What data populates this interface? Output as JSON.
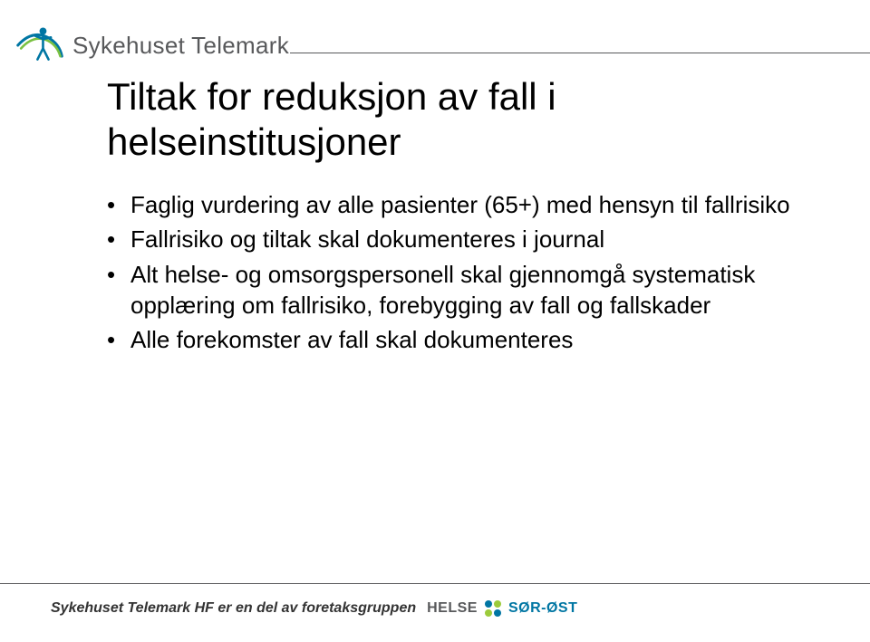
{
  "logo": {
    "text": "Sykehuset Telemark"
  },
  "title": "Tiltak for reduksjon av fall i helseinstitusjoner",
  "bullets": [
    "Faglig vurdering av alle pasienter (65+) med hensyn til fallrisiko",
    "Fallrisiko og tiltak skal dokumenteres i journal",
    "Alt helse- og omsorgspersonell skal gjennomgå systematisk opplæring om fallrisiko, forebygging av fall og fallskader",
    "Alle forekomster av fall skal dokumenteres"
  ],
  "footer": {
    "text": "Sykehuset Telemark HF er en del av foretaksgruppen",
    "brand1": "HELSE",
    "brand2": "SØR-ØST"
  }
}
